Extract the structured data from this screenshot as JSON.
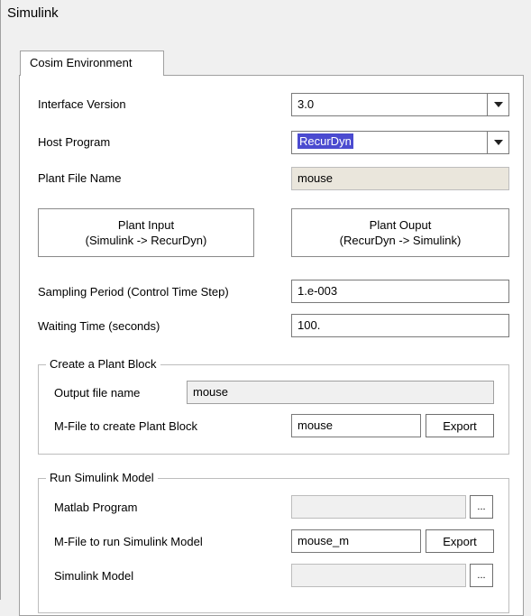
{
  "window": {
    "title": "Simulink"
  },
  "tabs": [
    {
      "label": "Cosim Environment"
    }
  ],
  "form": {
    "interface_version": {
      "label": "Interface Version",
      "value": "3.0"
    },
    "host_program": {
      "label": "Host Program",
      "value": "RecurDyn"
    },
    "plant_file_name": {
      "label": "Plant File Name",
      "value": "mouse"
    },
    "plant_input_button": {
      "line1": "Plant Input",
      "line2": "(Simulink -> RecurDyn)"
    },
    "plant_output_button": {
      "line1": "Plant Ouput",
      "line2": "(RecurDyn -> Simulink)"
    },
    "sampling_period": {
      "label": "Sampling Period (Control Time Step)",
      "value": "1.e-003"
    },
    "waiting_time": {
      "label": "Waiting Time (seconds)",
      "value": "100."
    }
  },
  "create_plant_block": {
    "title": "Create a Plant Block",
    "output_file_label": "Output file name",
    "output_file_value": "mouse",
    "mfile_label": "M-File to create Plant Block",
    "mfile_value": "mouse",
    "export_label": "Export"
  },
  "run_simulink_model": {
    "title": "Run Simulink Model",
    "matlab_program_label": "Matlab Program",
    "matlab_program_value": "",
    "browse_label": "...",
    "mfile_label": "M-File to run Simulink Model",
    "mfile_value": "mouse_m",
    "export_label": "Export",
    "simulink_model_label": "Simulink Model",
    "simulink_model_value": ""
  },
  "icons": {
    "dropdown": "chevron-down-icon"
  }
}
